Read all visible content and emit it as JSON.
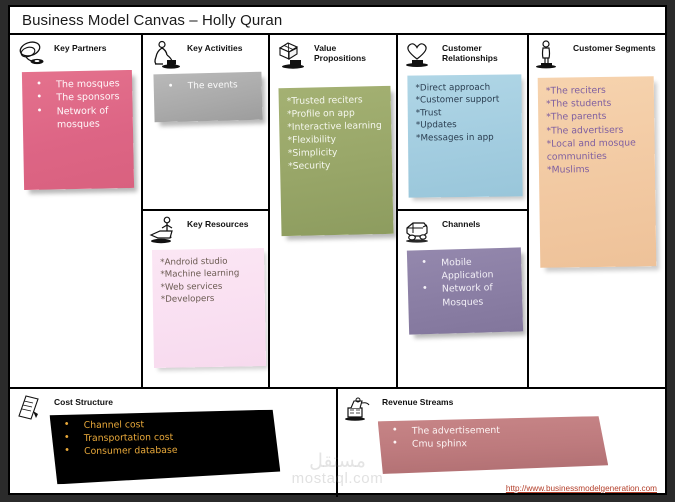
{
  "header": {
    "title": "Business Model Canvas – Holly Quran"
  },
  "blocks": {
    "key_partners": {
      "label": "Key Partners",
      "icon": "chain-links-icon",
      "note_color": "#dd6585",
      "items": [
        "The mosques",
        "The sponsors",
        "Network of mosques"
      ]
    },
    "key_activities": {
      "label": "Key Activities",
      "icon": "person-sweeping-icon",
      "note_color": "#a9a9a9",
      "items": [
        "The events"
      ]
    },
    "key_resources": {
      "label": "Key Resources",
      "icon": "person-with-cart-icon",
      "note_color": "#f9dff1",
      "items": [
        "*Android studio",
        "*Machine learning",
        "*Web services",
        "*Developers"
      ]
    },
    "value_propositions": {
      "label": "Value\nPropositions",
      "icon": "gift-box-icon",
      "note_color": "#98a668",
      "items": [
        "*Trusted reciters",
        "*Profile on app",
        "*Interactive learning",
        "*Flexibility",
        "*Simplicity",
        "*Security"
      ]
    },
    "customer_relationships": {
      "label": "Customer\nRelationships",
      "icon": "heart-icon",
      "note_color": "#a3cde0",
      "items": [
        "*Direct approach",
        "*Customer support",
        "*Trust",
        "*Updates",
        "*Messages in app"
      ]
    },
    "channels": {
      "label": "Channels",
      "icon": "truck-icon",
      "note_color": "#8a7ea4",
      "items": [
        "Mobile Application",
        "Network of Mosques"
      ]
    },
    "customer_segments": {
      "label": "Customer Segments",
      "icon": "standing-person-icon",
      "note_color": "#f2c9a2",
      "items": [
        "*The reciters",
        "*The students",
        "*The parents",
        "*The advertisers",
        "*Local and mosque communities",
        "*Muslims"
      ]
    },
    "cost_structure": {
      "label": "Cost  Structure",
      "icon": "invoice-papers-icon",
      "note_color": "#000000",
      "accent_color": "#e9a93a",
      "items": [
        "Channel cost",
        "Transportation cost",
        "Consumer database"
      ]
    },
    "revenue_streams": {
      "label": "Revenue Streams",
      "icon": "cash-register-icon",
      "note_color": "#bd7a7d",
      "items": [
        "The advertisement",
        "Cmu sphinx"
      ]
    }
  },
  "footer": {
    "link_text": "http://www.businessmodelgeneration.com"
  },
  "watermark": {
    "arabic": "مستقل",
    "latin": "mostaql.com"
  }
}
